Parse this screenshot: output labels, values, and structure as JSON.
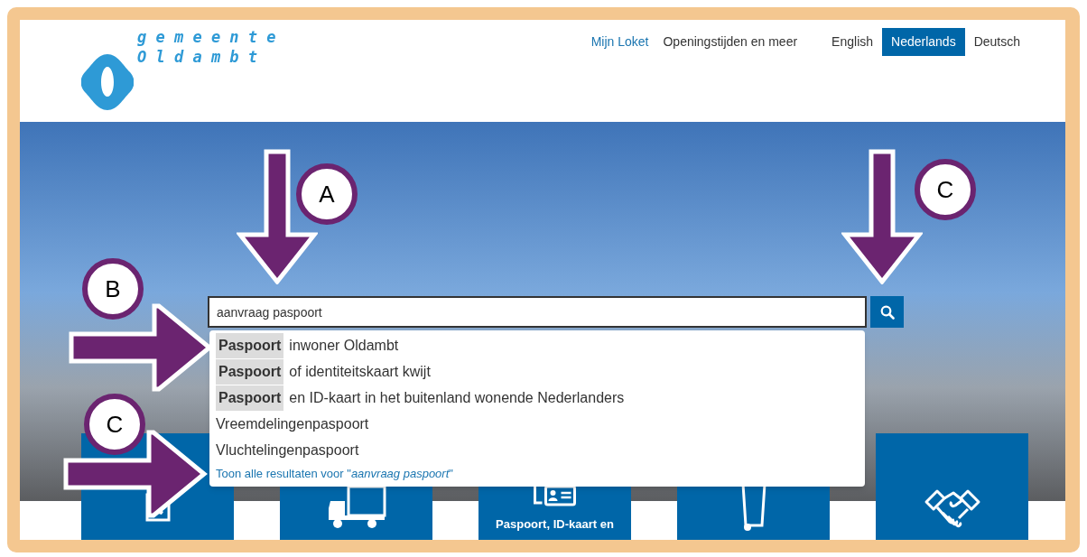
{
  "logo": {
    "line_1": "g e m e e n t e",
    "line_2": "O l d a m b t"
  },
  "top_links": [
    {
      "label": "Mijn Loket",
      "kind": "link"
    },
    {
      "label": "Openingstijden en meer",
      "kind": "plain"
    }
  ],
  "languages": [
    {
      "label": "English",
      "selected": false
    },
    {
      "label": "Nederlands",
      "selected": true
    },
    {
      "label": "Deutsch",
      "selected": false
    }
  ],
  "search": {
    "value": "aanvraag paspoort"
  },
  "suggestions": [
    {
      "highlight": "Paspoort",
      "text": "inwoner Oldambt"
    },
    {
      "highlight": "Paspoort",
      "text": "of identiteitskaart kwijt"
    },
    {
      "highlight": "Paspoort",
      "text": "en ID-kaart in het buitenland wonende Nederlanders"
    },
    {
      "text": "Vreemdelingenpaspoort"
    },
    {
      "text": "Vluchtelingenpaspoort"
    }
  ],
  "all_results_link": "Toon alle resultaten voor \"*aanvraag paspoort*\"",
  "tiles": [
    {
      "kind": "icon"
    },
    {
      "kind": "icon"
    },
    {
      "kind": "labelled",
      "label": "Paspoort, ID-kaart en"
    },
    {
      "kind": "icon"
    },
    {
      "kind": "icon"
    }
  ],
  "annotations": [
    {
      "label": "A",
      "kind": "down"
    },
    {
      "label": "C",
      "kind": "down"
    },
    {
      "label": "B",
      "kind": "right"
    },
    {
      "label": "C",
      "kind": "right"
    }
  ]
}
